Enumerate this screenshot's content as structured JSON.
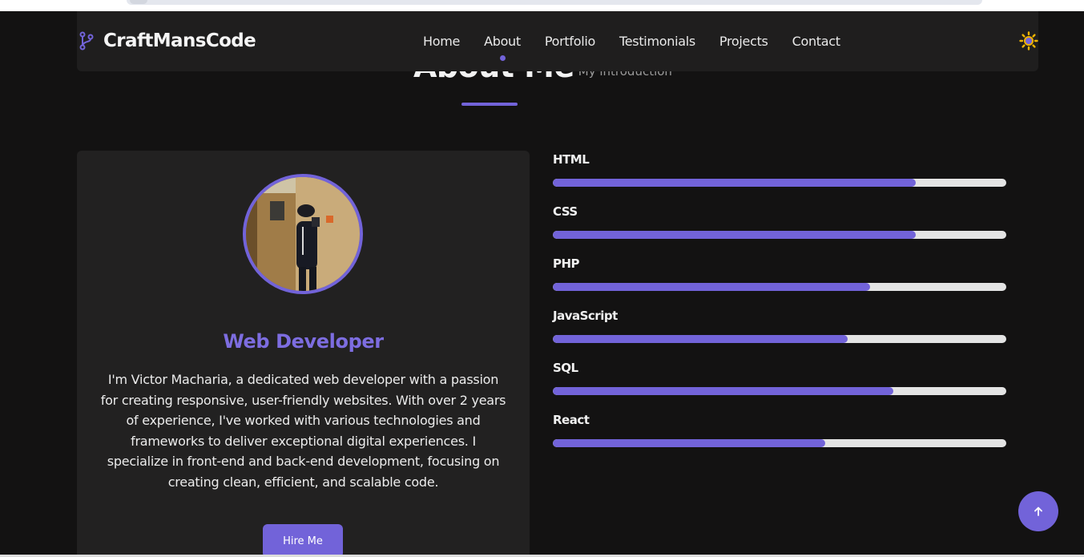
{
  "brand": {
    "name": "CraftMansCode",
    "icon": "git-branch-icon"
  },
  "nav": {
    "links": [
      {
        "label": "Home"
      },
      {
        "label": "About",
        "active": true
      },
      {
        "label": "Portfolio"
      },
      {
        "label": "Testimonials"
      },
      {
        "label": "Projects"
      },
      {
        "label": "Contact"
      }
    ],
    "theme_icon": "sun-icon"
  },
  "section": {
    "title": "About Me",
    "subtitle": "My introduction"
  },
  "about": {
    "role": "Web Developer",
    "bio": "I'm Victor Macharia, a dedicated web developer with a passion for creating responsive, user-friendly websites. With over 2 years of experience, I've worked with various technologies and frameworks to deliver exceptional digital experiences. I specialize in front-end and back-end development, focusing on creating clean, efficient, and scalable code.",
    "hire_label": "Hire Me"
  },
  "skills": [
    {
      "name": "HTML",
      "level": 0.8
    },
    {
      "name": "CSS",
      "level": 0.8
    },
    {
      "name": "PHP",
      "level": 0.7
    },
    {
      "name": "JavaScript",
      "level": 0.65
    },
    {
      "name": "SQL",
      "level": 0.75
    },
    {
      "name": "React",
      "level": 0.6
    }
  ],
  "scroll_top_icon": "arrow-up-icon",
  "colors": {
    "accent": "#7263d9",
    "background": "#131212",
    "card": "#222121",
    "track": "#e4e4e4"
  }
}
